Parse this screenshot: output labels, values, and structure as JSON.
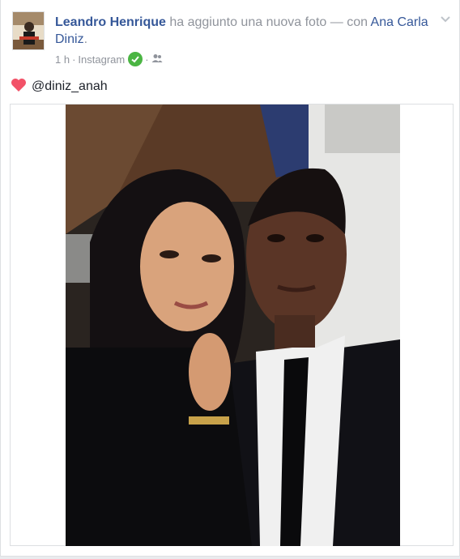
{
  "post": {
    "author": "Leandro Henrique",
    "action": " ha aggiunto una nuova foto — con ",
    "tagged": "Ana Carla Diniz",
    "tagged_suffix": ".",
    "time": "1 h",
    "separator1": " · ",
    "via": "Instagram",
    "separator2": " · ",
    "audience_icon": "friends-icon",
    "caption_emoji": "heart-icon",
    "caption": "@diniz_anah",
    "menu_icon": "chevron-down-icon"
  },
  "colors": {
    "link": "#365899",
    "meta": "#90949c",
    "heart": "#f25268",
    "verified": "#4bb543"
  }
}
